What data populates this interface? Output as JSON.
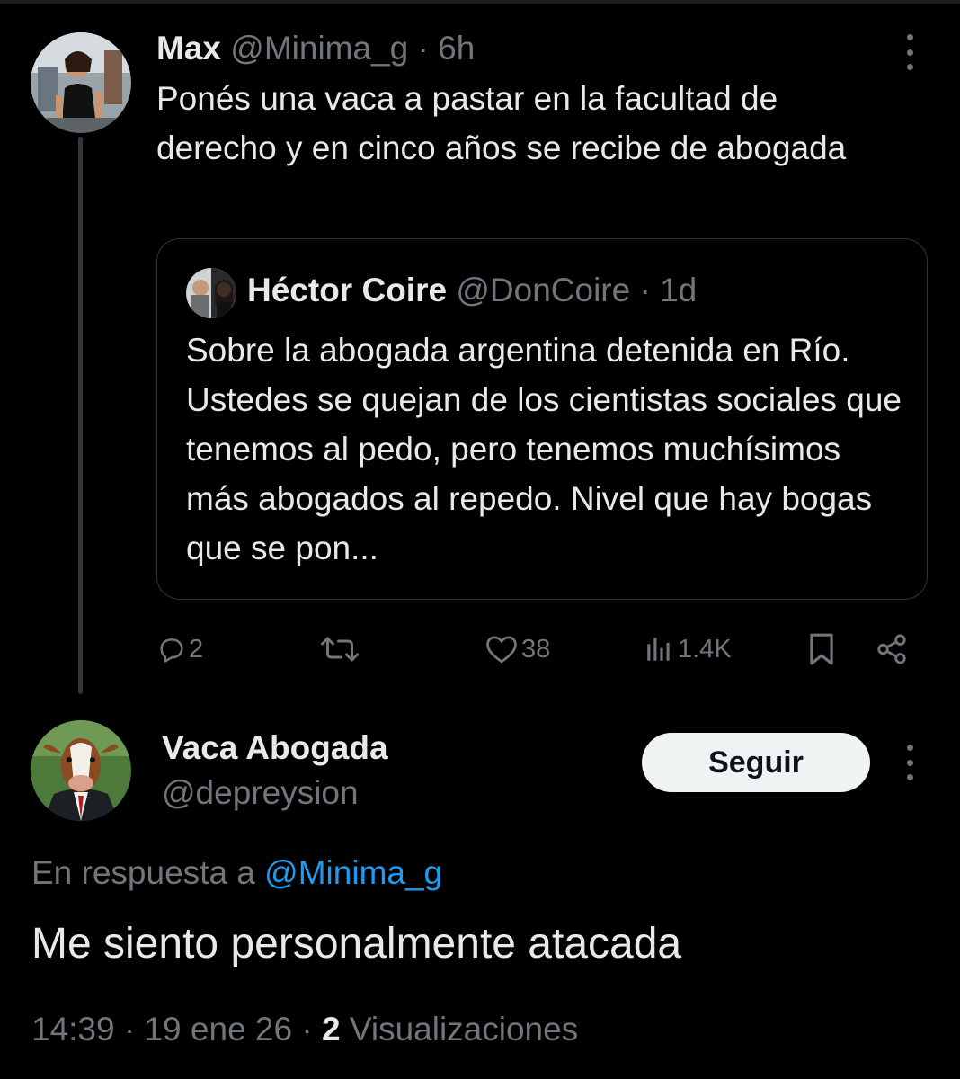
{
  "original_post": {
    "author_name": "Max",
    "author_handle": "@Minima_g",
    "separator": "·",
    "time": "6h",
    "text": "Ponés una vaca a pastar en la facultad de derecho y en cinco años se recibe de abogada",
    "avatar_icon": "woman-street-photo-avatar"
  },
  "quoted_post": {
    "author_name": "Héctor Coire",
    "author_handle": "@DonCoire",
    "separator": "·",
    "time": "1d",
    "text": "Sobre la abogada argentina detenida en Río. Ustedes se quejan de los cientistas sociales que tenemos al pedo, pero tenemos muchísimos más abogados al repedo. Nivel que hay bogas que se pon..."
  },
  "actions": {
    "replies": "2",
    "retweets": "",
    "likes": "38",
    "views": "1.4K"
  },
  "reply": {
    "author_name": "Vaca Abogada",
    "author_handle": "@depreysion",
    "follow_label": "Seguir",
    "in_reply_prefix": "En respuesta a ",
    "in_reply_handle": "@Minima_g",
    "text": "Me siento personalmente atacada",
    "time": "14:39",
    "date": "19 ene 26",
    "views_count": "2",
    "views_label": "Visualizaciones",
    "avatar_icon": "cow-in-suit-avatar"
  },
  "colors": {
    "background": "#000000",
    "text": "#e7e9ea",
    "muted": "#71767b",
    "link": "#1d9bf0",
    "border": "#2f3336",
    "button_bg": "#eff3f4"
  }
}
